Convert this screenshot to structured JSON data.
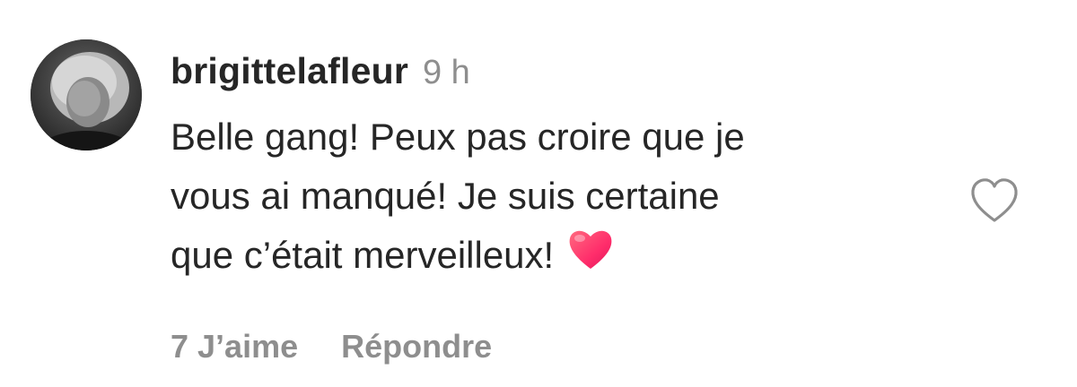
{
  "comment": {
    "username": "brigittelafleur",
    "time": "9 h",
    "text_lines": [
      "Belle gang! Peux pas croire que je",
      "vous ai manqué! Je suis certaine",
      "que c’était merveilleux!"
    ],
    "emoji": "heart-emoji",
    "likes_label": "7 J’aime",
    "reply_label": "Répondre",
    "like_icon": "heart-outline-icon",
    "colors": {
      "text": "#262626",
      "muted": "#8e8e8e",
      "heart_emoji": "#ff3b6b"
    }
  }
}
